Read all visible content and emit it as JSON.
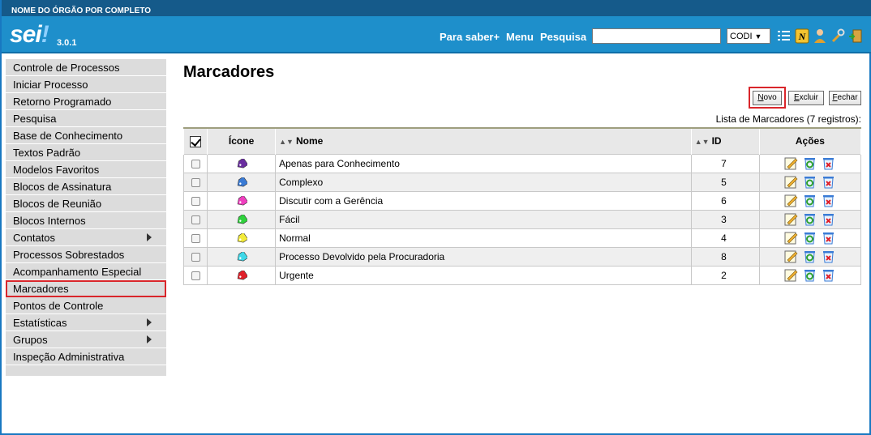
{
  "header": {
    "org_name": "NOME DO ÓRGÃO POR COMPLETO",
    "logo_text": "sei",
    "logo_dot": "!",
    "version": "3.0.1",
    "links": {
      "para_saber": "Para saber+",
      "menu": "Menu",
      "pesquisa": "Pesquisa"
    },
    "search_value": "",
    "unit": "CODI",
    "icons": [
      "list-icon",
      "notes-n-icon",
      "user-icon",
      "tools-icon",
      "exit-icon"
    ]
  },
  "sidebar": {
    "items": [
      {
        "label": "Controle de Processos",
        "submenu": false
      },
      {
        "label": "Iniciar Processo",
        "submenu": false
      },
      {
        "label": "Retorno Programado",
        "submenu": false
      },
      {
        "label": "Pesquisa",
        "submenu": false
      },
      {
        "label": "Base de Conhecimento",
        "submenu": false
      },
      {
        "label": "Textos Padrão",
        "submenu": false
      },
      {
        "label": "Modelos Favoritos",
        "submenu": false
      },
      {
        "label": "Blocos de Assinatura",
        "submenu": false
      },
      {
        "label": "Blocos de Reunião",
        "submenu": false
      },
      {
        "label": "Blocos Internos",
        "submenu": false
      },
      {
        "label": "Contatos",
        "submenu": true
      },
      {
        "label": "Processos Sobrestados",
        "submenu": false
      },
      {
        "label": "Acompanhamento Especial",
        "submenu": false
      },
      {
        "label": "Marcadores",
        "submenu": false
      },
      {
        "label": "Pontos de Controle",
        "submenu": false
      },
      {
        "label": "Estatísticas",
        "submenu": true
      },
      {
        "label": "Grupos",
        "submenu": true
      },
      {
        "label": "Inspeção Administrativa",
        "submenu": false
      }
    ]
  },
  "main": {
    "title": "Marcadores",
    "buttons": {
      "novo": {
        "accel": "N",
        "rest": "ovo"
      },
      "excluir": {
        "accel": "E",
        "rest": "xcluir"
      },
      "fechar": {
        "accel": "F",
        "rest": "echar"
      }
    },
    "count_text": "Lista de Marcadores (7 registros):",
    "columns": {
      "icon": "Ícone",
      "name": "Nome",
      "id": "ID",
      "actions": "Ações"
    },
    "rows": [
      {
        "name": "Apenas para Conhecimento",
        "id": "7",
        "color": "#6a2ea0"
      },
      {
        "name": "Complexo",
        "id": "5",
        "color": "#3a7bd5"
      },
      {
        "name": "Discutir com a Gerência",
        "id": "6",
        "color": "#ef3fbf"
      },
      {
        "name": "Fácil",
        "id": "3",
        "color": "#2fd13c"
      },
      {
        "name": "Normal",
        "id": "4",
        "color": "#f2ea3a"
      },
      {
        "name": "Processo Devolvido pela Procuradoria",
        "id": "8",
        "color": "#3fd8e8"
      },
      {
        "name": "Urgente",
        "id": "2",
        "color": "#e0202a"
      }
    ]
  },
  "colors": {
    "header_bg": "#1e8fcb",
    "top_bar_bg": "#155a8a",
    "menu_bg": "#dcdcdc",
    "highlight": "#d9262b"
  }
}
